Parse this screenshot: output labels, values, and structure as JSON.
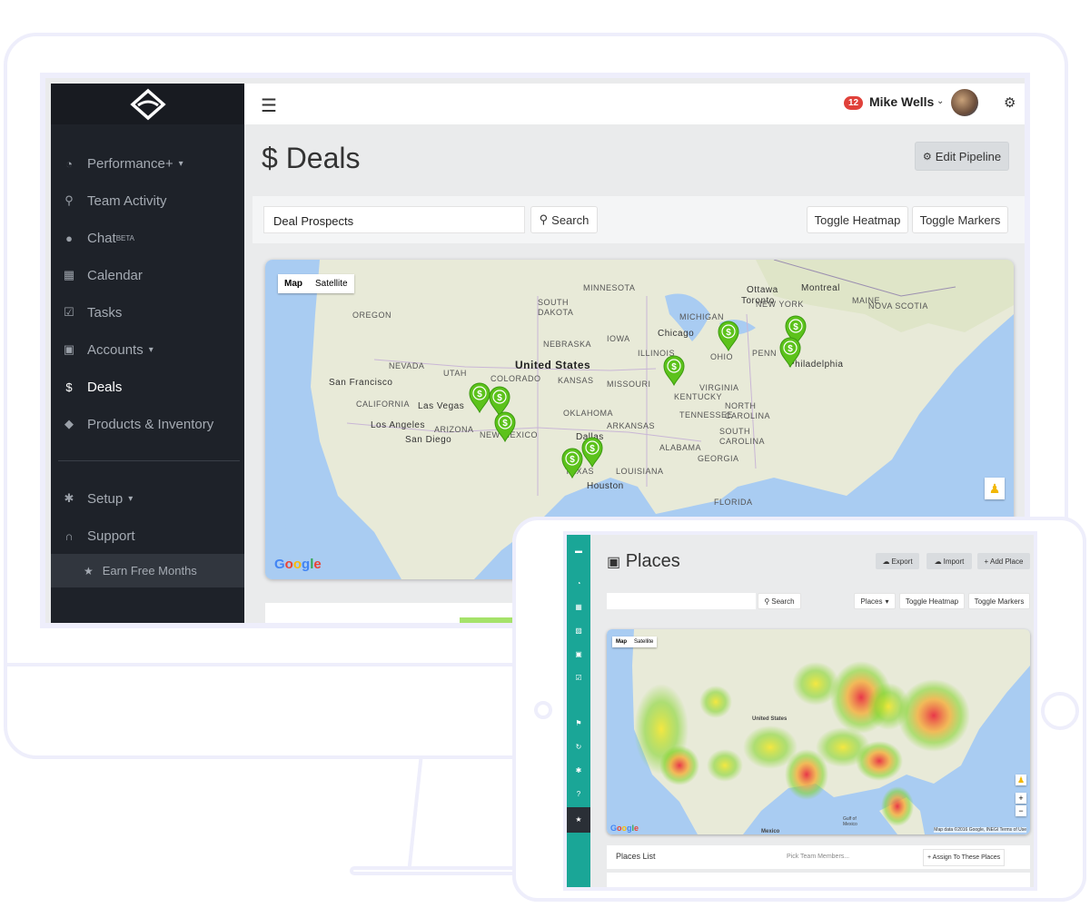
{
  "sidebar": {
    "items": [
      {
        "label": "Performance+",
        "icon": "dashboard-icon",
        "caret": true
      },
      {
        "label": "Team Activity",
        "icon": "map-marker-icon"
      },
      {
        "label": "Chat",
        "sup": "BETA",
        "icon": "comments-icon"
      },
      {
        "label": "Calendar",
        "icon": "calendar-icon"
      },
      {
        "label": "Tasks",
        "icon": "check-square-icon"
      },
      {
        "label": "Accounts",
        "icon": "briefcase-icon",
        "caret": true
      },
      {
        "label": "Deals",
        "icon": "dollar-icon",
        "active": true
      },
      {
        "label": "Products & Inventory",
        "icon": "tags-icon"
      },
      {
        "label": "Setup",
        "icon": "gear-icon",
        "caret": true
      },
      {
        "label": "Support",
        "icon": "headset-icon"
      }
    ],
    "earn_label": "Earn Free Months"
  },
  "topbar": {
    "notification_count": "12",
    "user_name": "Mike Wells"
  },
  "deals": {
    "title_symbol": "$",
    "title": "Deals",
    "edit_pipeline_label": "Edit Pipeline",
    "search_value": "Deal Prospects",
    "search_button": "Search",
    "toggle_heatmap": "Toggle Heatmap",
    "toggle_markers": "Toggle Markers"
  },
  "map": {
    "tab_map": "Map",
    "tab_satellite": "Satellite",
    "google": "Google",
    "labels": [
      "OREGON",
      "NEVADA",
      "San Francisco",
      "CALIFORNIA",
      "Las Vegas",
      "Los Angeles",
      "San Diego",
      "UTAH",
      "ARIZONA",
      "COLORADO",
      "NEW MEXICO",
      "United States",
      "SOUTH DAKOTA",
      "NEBRASKA",
      "KANSAS",
      "OKLAHOMA",
      "TEXAS",
      "Houston",
      "Dallas",
      "MINNESOTA",
      "IOWA",
      "MISSOURI",
      "ILLINOIS",
      "Chicago",
      "ARKANSAS",
      "LOUISIANA",
      "MICHIGAN",
      "OHIO",
      "KENTUCKY",
      "TENNESSEE",
      "ALABAMA",
      "GEORGIA",
      "FLORIDA",
      "VIRGINIA",
      "NORTH CAROLINA",
      "SOUTH CAROLINA",
      "PENN",
      "NEW YORK",
      "Philadelphia",
      "Toronto",
      "Ottawa",
      "Montreal",
      "MAINE",
      "NOVA SCOTIA"
    ],
    "marker_count": 9,
    "marker_color": "#5cc21b"
  },
  "tablet": {
    "title": "Places",
    "export_label": "Export",
    "import_label": "Import",
    "add_place_label": "+ Add Place",
    "search_button": "Search",
    "places_dropdown": "Places",
    "toggle_heatmap": "Toggle Heatmap",
    "toggle_markers": "Toggle Markers",
    "map_tab": "Map",
    "satellite_tab": "Satellite",
    "google": "Google",
    "map_data": "Map data ©2016 Google, INEGI   Terms of Use",
    "places_list_label": "Places List",
    "pick_team_placeholder": "Pick Team Members...",
    "assign_label": "+ Assign To These Places"
  },
  "colors": {
    "sidebar_bg": "#1e2229",
    "tablet_sidebar": "#1aa697",
    "badge": "#e0413a",
    "frame": "#eeeefb"
  }
}
